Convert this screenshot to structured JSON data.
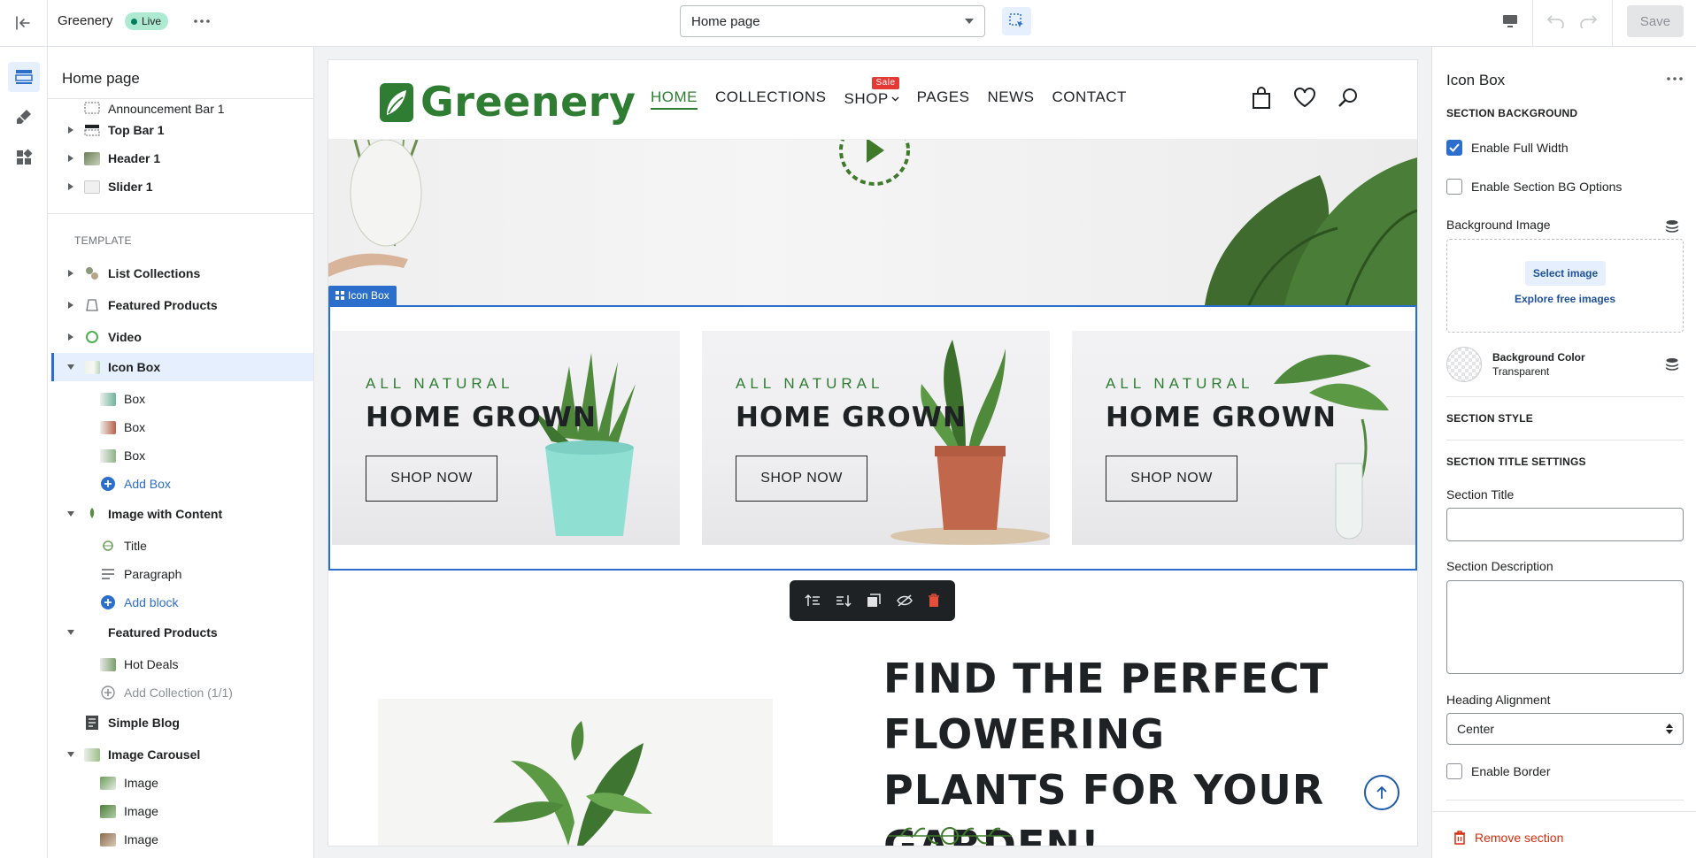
{
  "topbar": {
    "store_name": "Greenery",
    "status_badge": "Live",
    "page_selector_value": "Home page",
    "save_label": "Save"
  },
  "sidebar": {
    "title": "Home page",
    "header_sections": [
      "Announcement Bar 1",
      "Top Bar 1",
      "Header 1",
      "Slider 1"
    ],
    "template_label": "TEMPLATE",
    "sections": {
      "list_collections": "List Collections",
      "featured_products": "Featured Products",
      "video": "Video",
      "icon_box": "Icon Box",
      "icon_box_blocks": [
        "Box",
        "Box",
        "Box"
      ],
      "add_box": "Add Box",
      "image_with_content": "Image with Content",
      "image_with_content_blocks": [
        "Title",
        "Paragraph"
      ],
      "add_block": "Add block",
      "featured_products_2": "Featured Products",
      "featured_products_2_blocks": [
        "Hot Deals"
      ],
      "add_collection": "Add Collection (1/1)",
      "simple_blog": "Simple Blog",
      "image_carousel": "Image Carousel",
      "image_carousel_blocks": [
        "Image",
        "Image",
        "Image"
      ]
    }
  },
  "preview": {
    "logo_text": "Greenery",
    "nav": [
      "HOME",
      "COLLECTIONS",
      "SHOP",
      "PAGES",
      "NEWS",
      "CONTACT"
    ],
    "sale_tag": "Sale",
    "section_tag": "Icon Box",
    "boxes": [
      {
        "eyebrow": "ALL NATURAL",
        "title": "HOME GROWN",
        "button": "SHOP NOW"
      },
      {
        "eyebrow": "ALL NATURAL",
        "title": "HOME GROWN",
        "button": "SHOP NOW"
      },
      {
        "eyebrow": "ALL NATURAL",
        "title": "HOME GROWN",
        "button": "SHOP NOW"
      }
    ],
    "promo_heading": "FIND THE PERFECT FLOWERING PLANTS FOR YOUR GARDEN!"
  },
  "settings": {
    "title": "Icon Box",
    "section_background": "SECTION BACKGROUND",
    "enable_full_width": "Enable Full Width",
    "enable_full_width_checked": true,
    "enable_section_bg": "Enable Section BG Options",
    "enable_section_bg_checked": false,
    "background_image": "Background Image",
    "select_image": "Select image",
    "explore_images": "Explore free images",
    "background_color_label": "Background Color",
    "background_color_value": "Transparent",
    "section_style": "SECTION STYLE",
    "section_title_settings": "SECTION TITLE SETTINGS",
    "section_title_label": "Section Title",
    "section_title_value": "",
    "section_description_label": "Section Description",
    "section_description_value": "",
    "heading_alignment_label": "Heading Alignment",
    "heading_alignment_value": "Center",
    "enable_border": "Enable Border",
    "enable_border_checked": false,
    "remove_section": "Remove section"
  },
  "colors": {
    "brand_green": "#2e7d32",
    "accent_blue": "#2c6ecb",
    "danger": "#d72c0d",
    "live_badge": "#aee9d1"
  }
}
